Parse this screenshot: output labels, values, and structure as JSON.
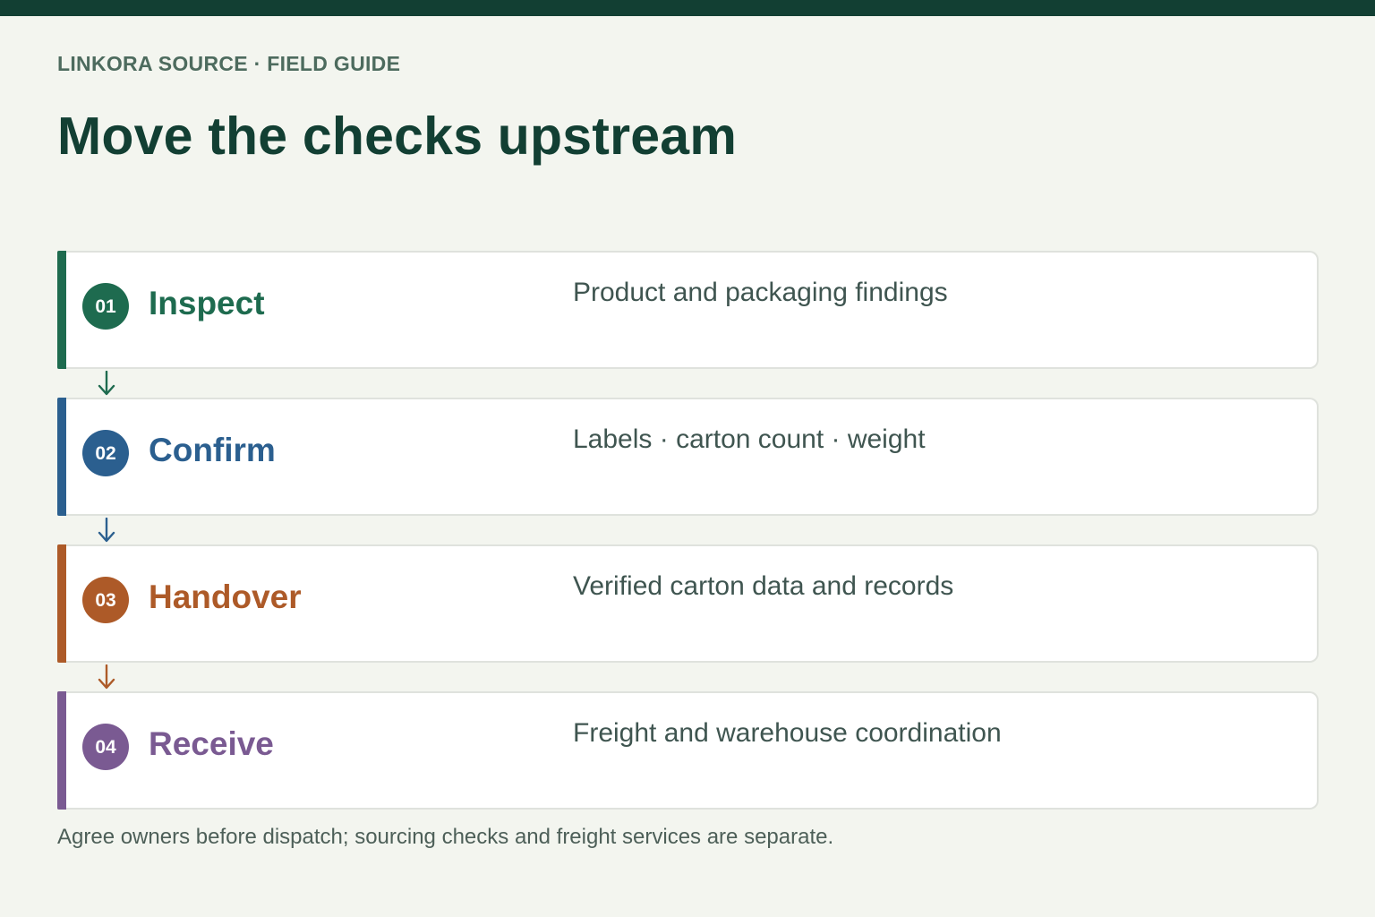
{
  "header": {
    "eyebrow": "LINKORA SOURCE · FIELD GUIDE",
    "title": "Move the checks upstream"
  },
  "steps": [
    {
      "number": "01",
      "name": "Inspect",
      "description": "Product and packaging findings",
      "color": "#1e6b4f"
    },
    {
      "number": "02",
      "name": "Confirm",
      "description": "Labels · carton count · weight",
      "color": "#2b5f8f"
    },
    {
      "number": "03",
      "name": "Handover",
      "description": "Verified carton data and records",
      "color": "#ad5a28"
    },
    {
      "number": "04",
      "name": "Receive",
      "description": "Freight and warehouse coordination",
      "color": "#7a5a92"
    }
  ],
  "connector_icon": "arrow-down-icon",
  "footnote": "Agree owners before dispatch; sourcing checks and freight services are separate."
}
